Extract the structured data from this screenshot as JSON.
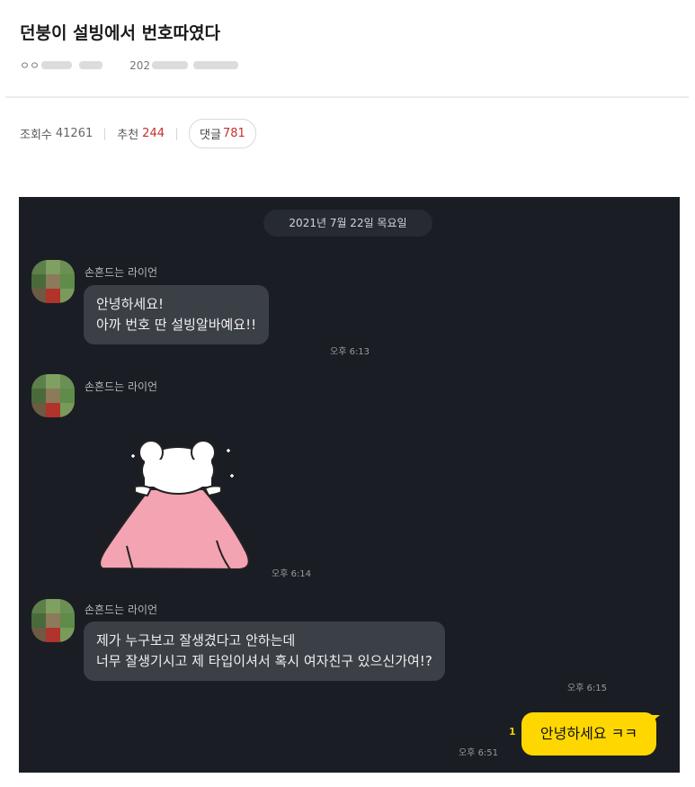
{
  "post": {
    "title": "던붕이 설빙에서 번호따였다",
    "author_visible": "ㅇㅇ",
    "date_visible": "202",
    "stats": {
      "views_label": "조회수",
      "views_value": "41261",
      "likes_label": "추천",
      "likes_value": "244",
      "comments_label": "댓글",
      "comments_value": "781"
    }
  },
  "chat": {
    "date_divider": "2021년 7월 22일 목요일",
    "messages": [
      {
        "sender": "손흔드는 라이언",
        "lines": [
          "안녕하세요!",
          "아까 번호 딴 설빙알바예요!!"
        ],
        "time": "오후 6:13"
      },
      {
        "sender": "손흔드는 라이언",
        "sticker": "pink-blanket-bear-sticker",
        "time": "오후 6:14"
      },
      {
        "sender": "손흔드는 라이언",
        "lines": [
          "제가 누구보고 잘생겼다고 안하는데",
          "너무 잘생기시고 제 타입이셔서 혹시 여자친구 있으신가여!?"
        ],
        "time": "오후 6:15"
      }
    ],
    "my_message": {
      "text": "안녕하세요 ㅋㅋ",
      "time": "오후 6:51",
      "unread": "1"
    }
  },
  "colors": {
    "chat_background": "#1a1d24",
    "bubble_other": "#3b3f46",
    "bubble_mine": "#ffd700",
    "accent_red": "#c4302b"
  }
}
